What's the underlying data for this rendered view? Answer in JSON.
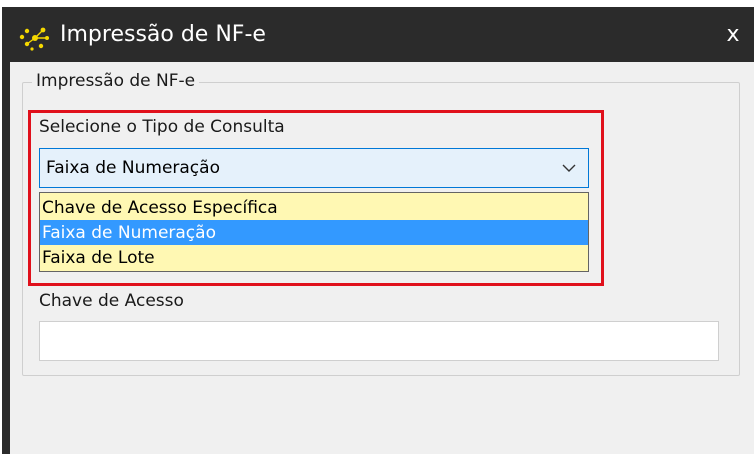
{
  "window": {
    "title": "Impressão de NF-e",
    "close_label": "x",
    "icon": "nfe-sparkle-icon"
  },
  "group": {
    "title": "Impressão de NF-e"
  },
  "query_type": {
    "label": "Selecione o Tipo de Consulta",
    "selected_value": "Faixa de Numeração",
    "options": [
      "Chave de Acesso Específica",
      "Faixa de Numeração",
      "Faixa de Lote"
    ],
    "selected_index": 1
  },
  "access_key": {
    "label": "Chave de Acesso",
    "value": ""
  },
  "colors": {
    "titlebar": "#2b2b2b",
    "highlight_border": "#e0101b",
    "dropdown_background": "#fff8b3",
    "selection": "#3399ff",
    "combo_background": "#e5f1fb",
    "icon_yellow": "#f5d800"
  }
}
